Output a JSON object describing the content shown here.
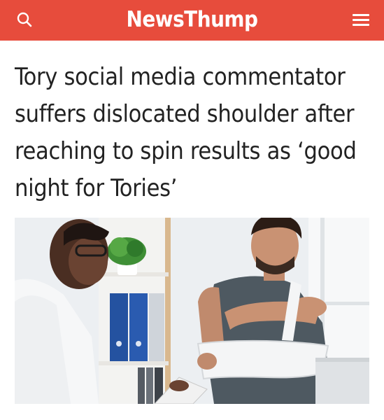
{
  "header": {
    "brand": "NewsThump",
    "background": "#e74c3c",
    "search_icon": "search-icon",
    "menu_icon": "hamburger-menu-icon"
  },
  "article": {
    "headline": "Tory social media commentator suffers dislocated shoulder after reaching to spin results as ‘good night for Tories’",
    "image": {
      "subject": "doctor-consulting-patient-with-arm-sling"
    }
  }
}
